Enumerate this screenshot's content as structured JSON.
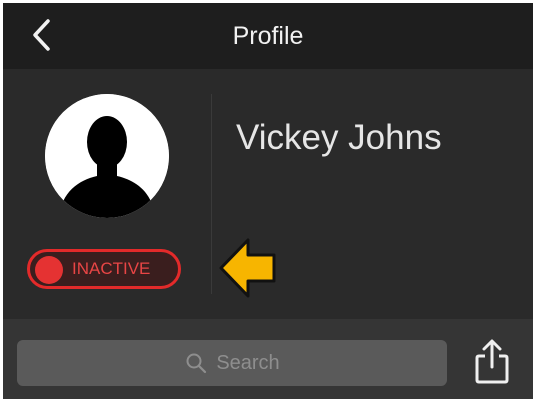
{
  "header": {
    "title": "Profile",
    "back_icon": "chevron-left-icon"
  },
  "profile": {
    "name": "Vickey Johns",
    "avatar_icon": "person-silhouette-icon",
    "status_label": "INACTIVE",
    "status_color": "#e53232",
    "pointer_icon": "arrow-left-icon",
    "pointer_color": "#f7b500"
  },
  "footer": {
    "search_placeholder": "Search",
    "search_icon": "search-icon",
    "share_icon": "share-icon"
  }
}
